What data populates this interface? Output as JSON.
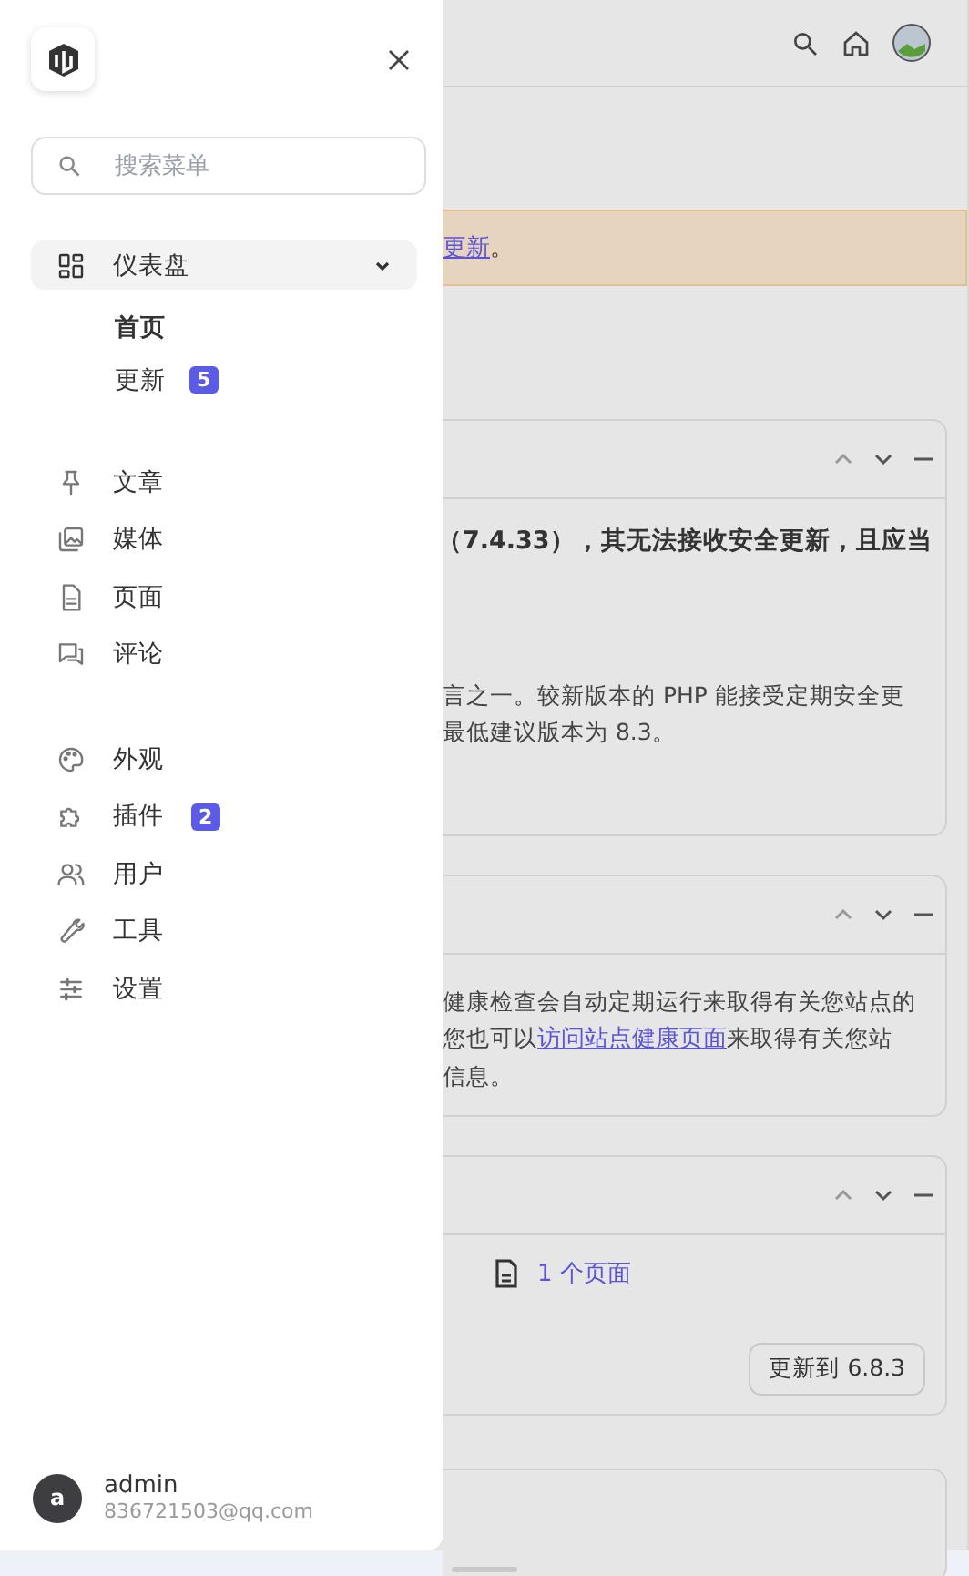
{
  "sidebar": {
    "search": {
      "placeholder": "搜索菜单"
    },
    "groups": [
      {
        "items": [
          {
            "label": "仪表盘",
            "selected": true,
            "expanded": true,
            "children": [
              {
                "label": "首页",
                "selected": true
              },
              {
                "label": "更新",
                "selected": false,
                "badge": "5"
              }
            ]
          }
        ]
      },
      {
        "items": [
          {
            "label": "文章",
            "selected": false
          },
          {
            "label": "媒体",
            "selected": false
          },
          {
            "label": "页面",
            "selected": false
          },
          {
            "label": "评论",
            "selected": false
          }
        ]
      },
      {
        "items": [
          {
            "label": "外观",
            "selected": false
          },
          {
            "label": "插件",
            "selected": false,
            "badge": "2"
          },
          {
            "label": "用户",
            "selected": false
          },
          {
            "label": "工具",
            "selected": false
          },
          {
            "label": "设置",
            "selected": false
          }
        ]
      }
    ],
    "user": {
      "initial": "a",
      "name": "admin",
      "email": "836721503@qq.com"
    }
  },
  "notice": {
    "link": "更新",
    "after": "。"
  },
  "cards": [
    {
      "kind": "warning",
      "bold": "（7.4.33），其无法接收安全更新，且应当",
      "lines": [
        [
          {
            "text": "言之一。较新版本的 PHP 能接受定期安全更"
          }
        ],
        [
          {
            "text": "最低建议版本为 8.3。"
          }
        ]
      ]
    },
    {
      "kind": "text",
      "lines": [
        [
          {
            "text": "健康检查会自动定期运行来取得有关您站点的"
          }
        ],
        [
          {
            "text": "您也可以"
          },
          {
            "text": "访问站点健康页面",
            "link": true
          },
          {
            "text": "来取得有关您站"
          }
        ],
        [
          {
            "text": "信息。"
          }
        ]
      ]
    },
    {
      "kind": "updates",
      "page_link": "1 个页面",
      "button": "更新到 6.8.3"
    },
    {
      "kind": "collapsed"
    }
  ]
}
